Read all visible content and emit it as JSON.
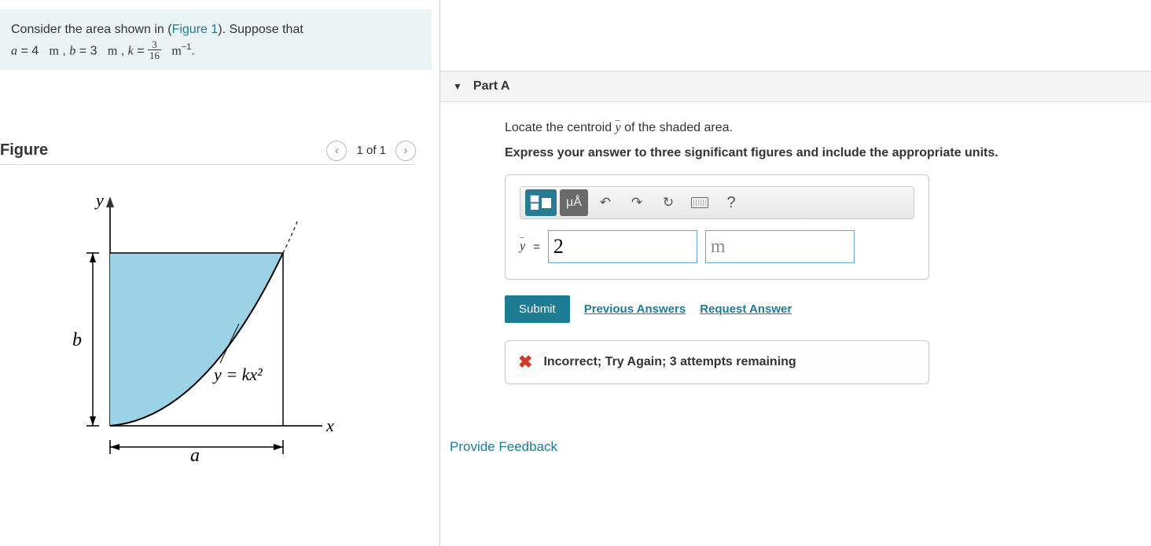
{
  "problem": {
    "intro_prefix": "Consider the area shown in (",
    "figure_link": "Figure 1",
    "intro_suffix": "). Suppose that",
    "a_label": "a",
    "a_value": "4",
    "b_label": "b",
    "b_value": "3",
    "k_label": "k",
    "k_num": "3",
    "k_den": "16",
    "length_unit": "m",
    "k_unit_m": "m",
    "k_unit_exp": "−1"
  },
  "figure": {
    "title": "Figure",
    "counter": "1 of 1",
    "y_axis": "y",
    "x_axis": "x",
    "b_label": "b",
    "a_label": "a",
    "curve_label": "y  =  kx²"
  },
  "part": {
    "title": "Part A",
    "instruction_prefix": "Locate the centroid ",
    "instruction_var": "y",
    "instruction_suffix": " of the shaded area.",
    "bold": "Express your answer to three significant figures and include the appropriate units.",
    "var_label": "y",
    "equals": " = ",
    "answer_value": "2",
    "answer_units": "m",
    "submit": "Submit",
    "prev_answers": "Previous Answers",
    "request": "Request Answer",
    "feedback": "Incorrect; Try Again; 3 attempts remaining"
  },
  "toolbar": {
    "units_label": "μÅ",
    "help": "?"
  },
  "footer": {
    "provide_feedback": "Provide Feedback"
  }
}
